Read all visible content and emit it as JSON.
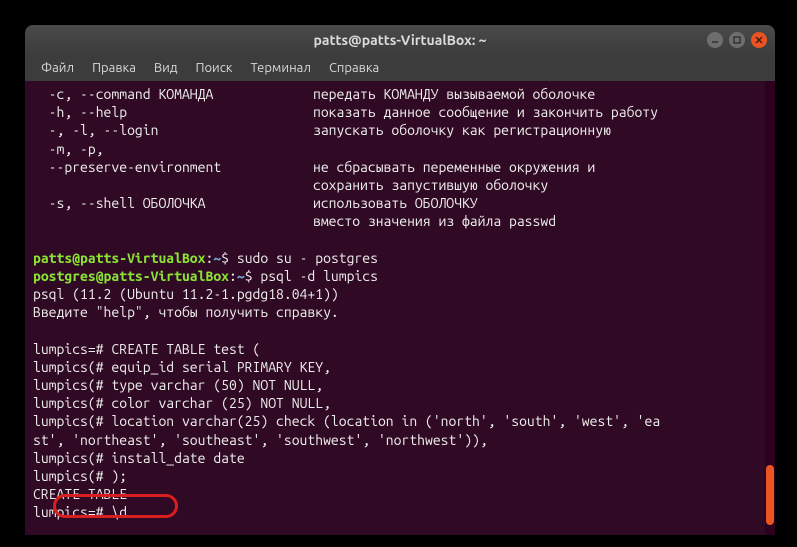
{
  "window": {
    "title": "patts@patts-VirtualBox: ~"
  },
  "menu": {
    "file": "Файл",
    "edit": "Правка",
    "view": "Вид",
    "search": "Поиск",
    "terminal": "Терминал",
    "help": "Справка"
  },
  "help_lines": {
    "l1a": "  -c, --command КОМАНДА",
    "l1b": "передать КОМАНДУ вызываемой оболочке",
    "l2a": "  -h, --help",
    "l2b": "показать данное сообщение и закончить работу",
    "l3a": "  -, -l, --login",
    "l3b": "запускать оболочку как регистрационную",
    "l4a": "  -m, -p,",
    "l4b": "",
    "l5a": "  --preserve-environment",
    "l5b": "не сбрасывать переменные окружения и",
    "l6a": "",
    "l6b": "сохранить запустившую оболочку",
    "l7a": "  -s, --shell ОБОЛОЧКА",
    "l7b": "использовать ОБОЛОЧКУ",
    "l8a": "",
    "l8b": "вместо значения из файла passwd"
  },
  "prompt1": {
    "user": "patts@patts-VirtualBox",
    "sep": ":",
    "path": "~",
    "sym": "$ ",
    "cmd": "sudo su - postgres"
  },
  "prompt2": {
    "user": "postgres@patts-VirtualBox",
    "sep": ":",
    "path": "~",
    "sym": "$ ",
    "cmd": "psql -d lumpics"
  },
  "psql": {
    "version": "psql (11.2 (Ubuntu 11.2-1.pgdg18.04+1))",
    "hint": "Введите \"help\", чтобы получить справку."
  },
  "sql": {
    "p1": "lumpics=# ",
    "p2": "lumpics(# ",
    "l1": "CREATE TABLE test (",
    "l2": "equip_id serial PRIMARY KEY,",
    "l3": "type varchar (50) NOT NULL,",
    "l4": "color varchar (25) NOT NULL,",
    "l5": "location varchar(25) check (location in ('north', 'south', 'west', 'ea",
    "l5b": "st', 'northeast', 'southeast', 'southwest', 'northwest')),",
    "l6": "install_date date",
    "l7": ");",
    "result": "CREATE TABLE",
    "cmd": "\\d"
  }
}
